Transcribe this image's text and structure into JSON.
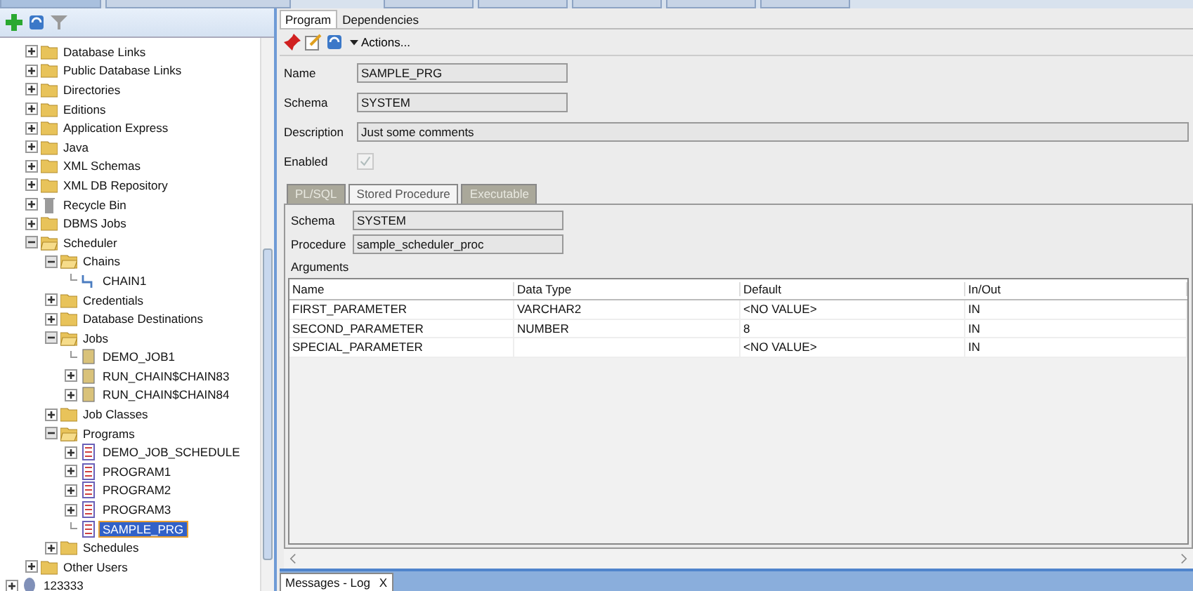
{
  "navigator": {
    "toolbar": [
      {
        "kind": "add"
      },
      {
        "kind": "refresh"
      },
      {
        "kind": "filter"
      }
    ],
    "tree": [
      {
        "label": "Database Links",
        "kind": "folder",
        "expandable": true,
        "expanded": false,
        "selected": false
      },
      {
        "label": "Public Database Links",
        "kind": "folder",
        "expandable": true,
        "expanded": false,
        "selected": false
      },
      {
        "label": "Directories",
        "kind": "folder",
        "expandable": true,
        "expanded": false,
        "selected": false
      },
      {
        "label": "Editions",
        "kind": "folder",
        "expandable": true,
        "expanded": false,
        "selected": false
      },
      {
        "label": "Application Express",
        "kind": "folder",
        "expandable": true,
        "expanded": false,
        "selected": false
      },
      {
        "label": "Java",
        "kind": "folder",
        "expandable": true,
        "expanded": false,
        "selected": false
      },
      {
        "label": "XML Schemas",
        "kind": "folder",
        "expandable": true,
        "expanded": false,
        "selected": false
      },
      {
        "label": "XML DB Repository",
        "kind": "folder",
        "expandable": true,
        "expanded": false,
        "selected": false
      },
      {
        "label": "Recycle Bin",
        "kind": "bin",
        "expandable": true,
        "expanded": false,
        "selected": false
      },
      {
        "label": "DBMS Jobs",
        "kind": "folder",
        "expandable": true,
        "expanded": false,
        "selected": false
      },
      {
        "label": "Scheduler",
        "kind": "folder",
        "expandable": true,
        "expanded": true,
        "selected": false,
        "children": [
          {
            "label": "Chains",
            "kind": "folder",
            "expandable": true,
            "expanded": true,
            "selected": false,
            "children": [
              {
                "label": "CHAIN1",
                "kind": "chain",
                "expandable": false,
                "selected": false
              }
            ]
          },
          {
            "label": "Credentials",
            "kind": "folder",
            "expandable": true,
            "expanded": false,
            "selected": false
          },
          {
            "label": "Database Destinations",
            "kind": "folder",
            "expandable": true,
            "expanded": false,
            "selected": false
          },
          {
            "label": "Jobs",
            "kind": "folder",
            "expandable": true,
            "expanded": true,
            "selected": false,
            "children": [
              {
                "label": "DEMO_JOB1",
                "kind": "job",
                "expandable": false,
                "selected": false
              },
              {
                "label": "RUN_CHAIN$CHAIN83",
                "kind": "job",
                "expandable": true,
                "expanded": false,
                "selected": false
              },
              {
                "label": "RUN_CHAIN$CHAIN84",
                "kind": "job",
                "expandable": true,
                "expanded": false,
                "selected": false
              }
            ]
          },
          {
            "label": "Job Classes",
            "kind": "folder",
            "expandable": true,
            "expanded": false,
            "selected": false
          },
          {
            "label": "Programs",
            "kind": "folder",
            "expandable": true,
            "expanded": true,
            "selected": false,
            "children": [
              {
                "label": "DEMO_JOB_SCHEDULE",
                "kind": "program",
                "expandable": true,
                "expanded": false,
                "selected": false
              },
              {
                "label": "PROGRAM1",
                "kind": "program",
                "expandable": true,
                "expanded": false,
                "selected": false
              },
              {
                "label": "PROGRAM2",
                "kind": "program",
                "expandable": true,
                "expanded": false,
                "selected": false
              },
              {
                "label": "PROGRAM3",
                "kind": "program",
                "expandable": true,
                "expanded": false,
                "selected": false
              },
              {
                "label": "SAMPLE_PRG",
                "kind": "program",
                "expandable": false,
                "selected": true
              }
            ]
          },
          {
            "label": "Schedules",
            "kind": "folder",
            "expandable": true,
            "expanded": false,
            "selected": false
          }
        ]
      },
      {
        "label": "Other Users",
        "kind": "folder",
        "expandable": true,
        "expanded": false,
        "selected": false
      }
    ]
  },
  "connections": [
    {
      "label": "123333",
      "kind": "database",
      "expandable": true,
      "expanded": false,
      "selected": false
    }
  ],
  "editor": {
    "tabs": [
      {
        "label": "Program",
        "selected": true
      },
      {
        "label": "Dependencies",
        "selected": false
      }
    ],
    "actions_label": "Actions...",
    "fields": [
      {
        "label": "Name",
        "value": "SAMPLE_PRG",
        "wide": false
      },
      {
        "label": "Schema",
        "value": "SYSTEM",
        "wide": false
      },
      {
        "label": "Description",
        "value": "Just some comments",
        "wide": true
      }
    ],
    "enabled": {
      "label": "Enabled",
      "checked": true,
      "disabled": true
    },
    "sub_tabs": [
      {
        "label": "PL/SQL",
        "selected": false
      },
      {
        "label": "Stored Procedure",
        "selected": true
      },
      {
        "label": "Executable",
        "selected": false
      }
    ],
    "procedure_fields": [
      {
        "label": "Schema",
        "value": "SYSTEM"
      },
      {
        "label": "Procedure",
        "value": "sample_scheduler_proc"
      }
    ],
    "arguments_label": "Arguments",
    "table": {
      "columns": [
        "Name",
        "Data Type",
        "Default",
        "In/Out"
      ],
      "rows": [
        [
          "FIRST_PARAMETER",
          "VARCHAR2",
          "<NO VALUE>",
          "IN"
        ],
        [
          "SECOND_PARAMETER",
          "NUMBER",
          "8",
          "IN"
        ],
        [
          "SPECIAL_PARAMETER",
          "",
          "<NO VALUE>",
          "IN"
        ]
      ]
    }
  },
  "bottom_panel": {
    "tab": "Messages - Log",
    "close": "X"
  }
}
